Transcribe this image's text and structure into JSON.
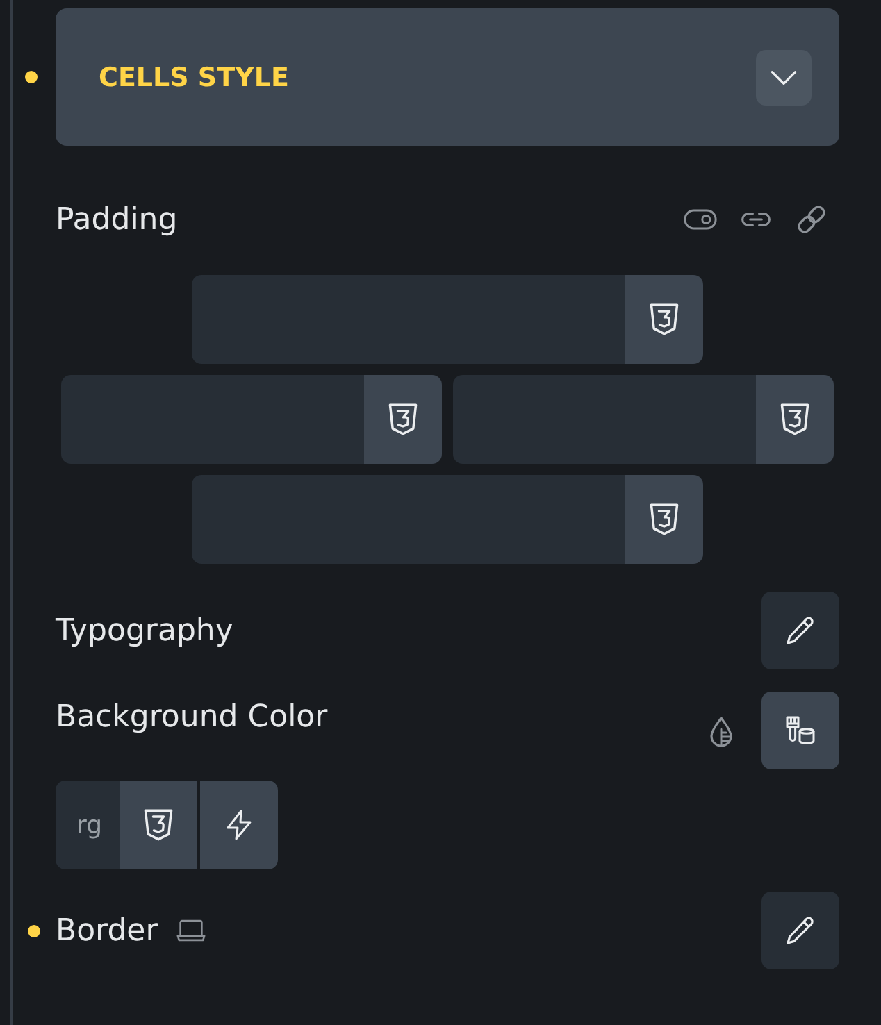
{
  "section": {
    "title": "CELLS STYLE",
    "modified": true
  },
  "padding": {
    "label": "Padding",
    "modified": false
  },
  "typography": {
    "label": "Typography",
    "modified": false
  },
  "background_color": {
    "label": "Background Color",
    "modified": false,
    "value": "rg"
  },
  "border": {
    "label": "Border",
    "modified": true
  }
}
